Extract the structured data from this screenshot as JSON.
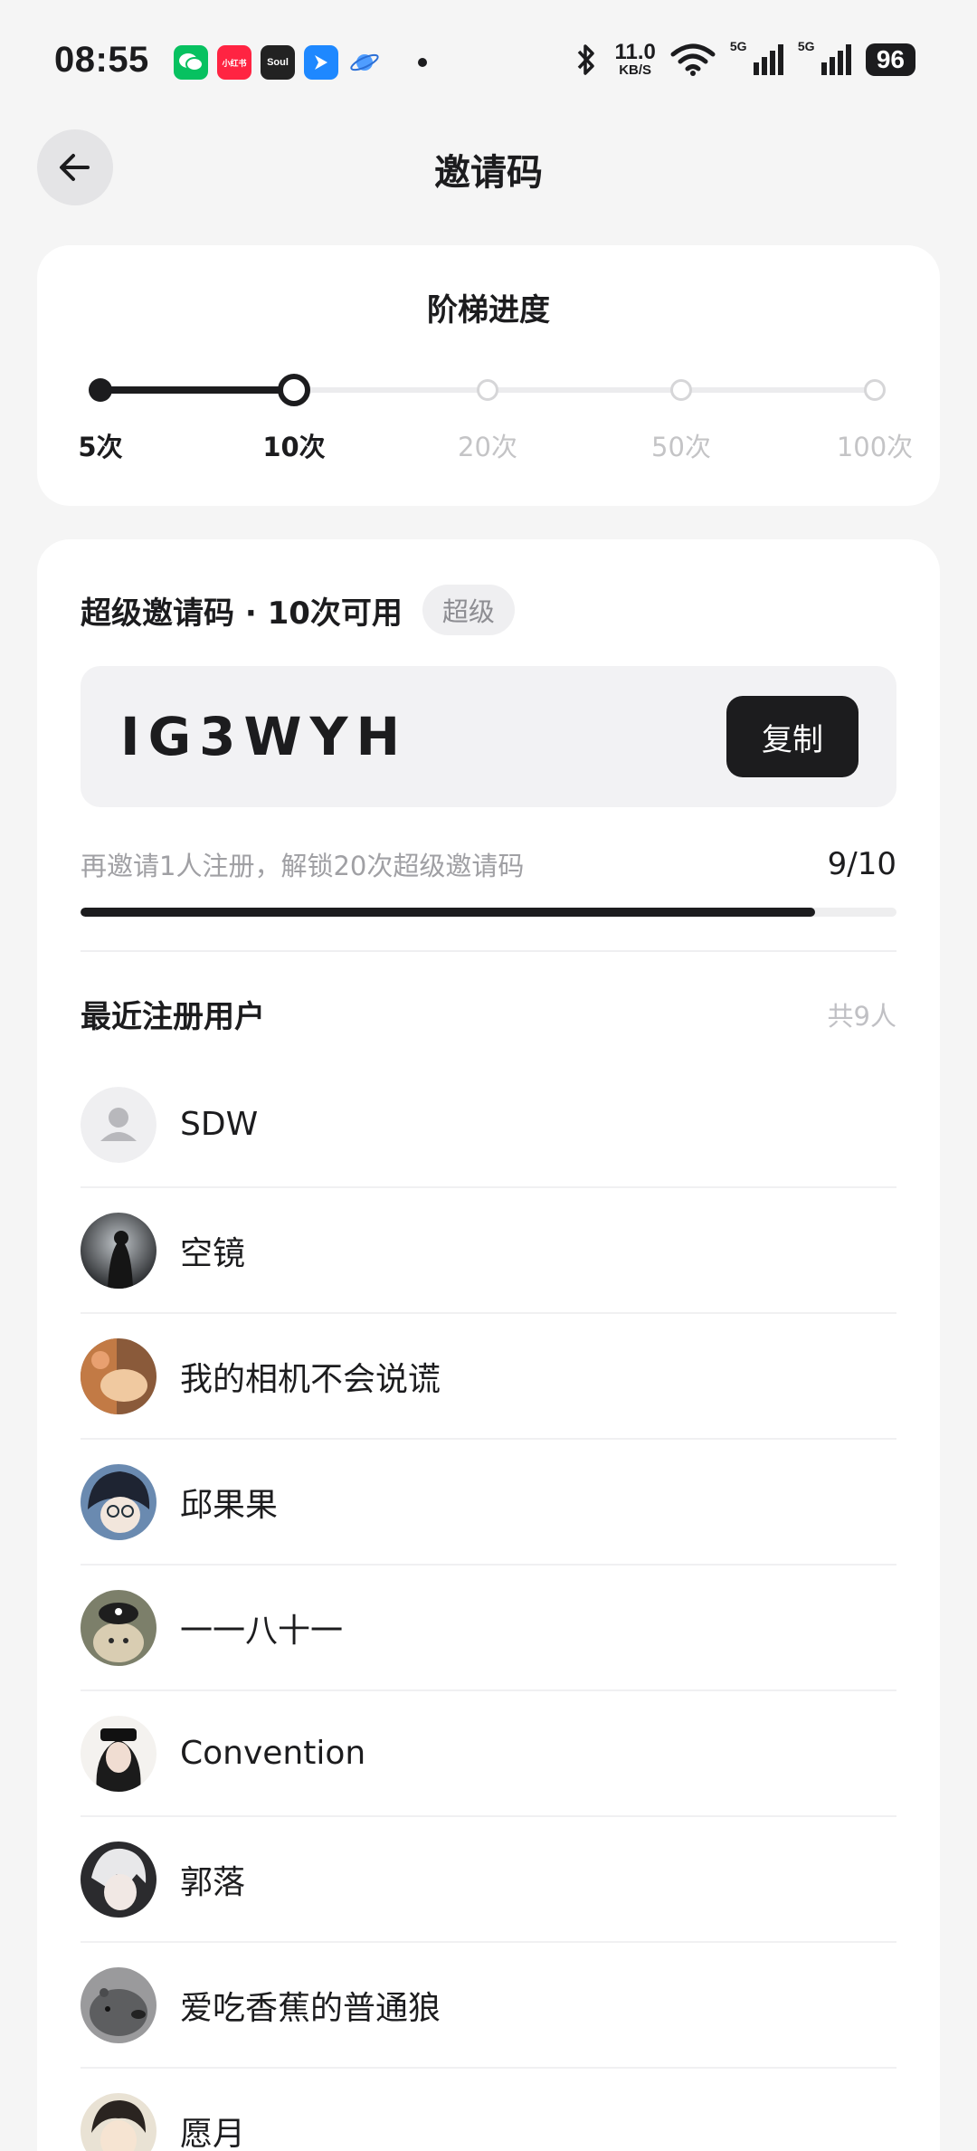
{
  "status_bar": {
    "time": "08:55",
    "apps": [
      {
        "icon": "wechat-icon",
        "color": "#07c160",
        "text": ""
      },
      {
        "icon": "xiaohongshu-icon",
        "color": "#ff2442",
        "text": "小红书"
      },
      {
        "icon": "soul-icon",
        "color": "#222222",
        "text": "Soul"
      },
      {
        "icon": "bird-app-icon",
        "color": "#1e88ff",
        "text": ""
      },
      {
        "icon": "planet-app-icon",
        "color": "#5fa8ff",
        "text": ""
      }
    ],
    "net_speed": "11.0",
    "net_speed_unit": "KB/S",
    "signal_tag_1": "5G",
    "signal_tag_2": "5G",
    "battery": "96"
  },
  "header": {
    "title": "邀请码"
  },
  "ladder": {
    "title": "阶梯进度",
    "current_index": 1,
    "steps": [
      {
        "label": "5次",
        "state": "done"
      },
      {
        "label": "10次",
        "state": "current"
      },
      {
        "label": "20次",
        "state": "todo"
      },
      {
        "label": "50次",
        "state": "todo"
      },
      {
        "label": "100次",
        "state": "todo"
      }
    ]
  },
  "invite": {
    "title": "超级邀请码 · 10次可用",
    "badge": "超级",
    "code": "IG3WYH",
    "copy_label": "复制",
    "unlock_tip": "再邀请1人注册，解锁20次超级邀请码",
    "progress_text": "9/10",
    "progress_value": 0.9
  },
  "users": {
    "title": "最近注册用户",
    "count_text": "共9人",
    "items": [
      {
        "name": "SDW",
        "avatar": "default-avatar-icon"
      },
      {
        "name": "空镜",
        "avatar": "photo-avatar"
      },
      {
        "name": "我的相机不会说谎",
        "avatar": "photo-avatar"
      },
      {
        "name": "邱果果",
        "avatar": "photo-avatar"
      },
      {
        "name": "一一八十一",
        "avatar": "photo-avatar"
      },
      {
        "name": "Convention",
        "avatar": "photo-avatar"
      },
      {
        "name": "郭落",
        "avatar": "photo-avatar"
      },
      {
        "name": "爱吃香蕉的普通狼",
        "avatar": "photo-avatar"
      },
      {
        "name": "愿月",
        "avatar": "photo-avatar"
      }
    ]
  }
}
